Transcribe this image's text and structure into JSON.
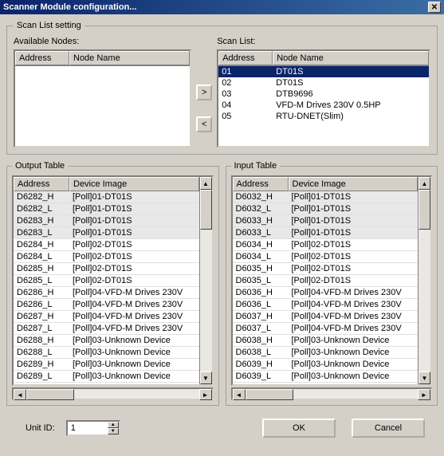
{
  "title": "Scanner Module configuration...",
  "scanListSetting": {
    "legend": "Scan List setting",
    "availableLabel": "Available Nodes:",
    "scanListLabel": "Scan List:",
    "headers": {
      "address": "Address",
      "nodeName": "Node Name"
    },
    "buttons": {
      "right": ">",
      "left": "<"
    },
    "scanList": [
      {
        "address": "01",
        "name": "DT01S",
        "selected": true
      },
      {
        "address": "02",
        "name": "DT01S",
        "selected": false
      },
      {
        "address": "03",
        "name": "DTB9696",
        "selected": false
      },
      {
        "address": "04",
        "name": "VFD-M Drives 230V 0.5HP",
        "selected": false
      },
      {
        "address": "05",
        "name": "RTU-DNET(Slim)",
        "selected": false
      }
    ]
  },
  "outputTable": {
    "legend": "Output Table",
    "headers": {
      "address": "Address",
      "device": "Device Image"
    },
    "rows": [
      {
        "addr": "D6282_H",
        "dev": "[Poll]01-DT01S",
        "shaded": true
      },
      {
        "addr": "D6282_L",
        "dev": "[Poll]01-DT01S",
        "shaded": true
      },
      {
        "addr": "D6283_H",
        "dev": "[Poll]01-DT01S",
        "shaded": true
      },
      {
        "addr": "D6283_L",
        "dev": "[Poll]01-DT01S",
        "shaded": true
      },
      {
        "addr": "D6284_H",
        "dev": "[Poll]02-DT01S",
        "shaded": false
      },
      {
        "addr": "D6284_L",
        "dev": "[Poll]02-DT01S",
        "shaded": false
      },
      {
        "addr": "D6285_H",
        "dev": "[Poll]02-DT01S",
        "shaded": false
      },
      {
        "addr": "D6285_L",
        "dev": "[Poll]02-DT01S",
        "shaded": false
      },
      {
        "addr": "D6286_H",
        "dev": "[Poll]04-VFD-M Drives 230V",
        "shaded": false
      },
      {
        "addr": "D6286_L",
        "dev": "[Poll]04-VFD-M Drives 230V",
        "shaded": false
      },
      {
        "addr": "D6287_H",
        "dev": "[Poll]04-VFD-M Drives 230V",
        "shaded": false
      },
      {
        "addr": "D6287_L",
        "dev": "[Poll]04-VFD-M Drives 230V",
        "shaded": false
      },
      {
        "addr": "D6288_H",
        "dev": "[Poll]03-Unknown Device",
        "shaded": false
      },
      {
        "addr": "D6288_L",
        "dev": "[Poll]03-Unknown Device",
        "shaded": false
      },
      {
        "addr": "D6289_H",
        "dev": "[Poll]03-Unknown Device",
        "shaded": false
      },
      {
        "addr": "D6289_L",
        "dev": "[Poll]03-Unknown Device",
        "shaded": false
      }
    ]
  },
  "inputTable": {
    "legend": "Input Table",
    "headers": {
      "address": "Address",
      "device": "Device Image"
    },
    "rows": [
      {
        "addr": "D6032_H",
        "dev": "[Poll]01-DT01S",
        "shaded": true
      },
      {
        "addr": "D6032_L",
        "dev": "[Poll]01-DT01S",
        "shaded": true
      },
      {
        "addr": "D6033_H",
        "dev": "[Poll]01-DT01S",
        "shaded": true
      },
      {
        "addr": "D6033_L",
        "dev": "[Poll]01-DT01S",
        "shaded": true
      },
      {
        "addr": "D6034_H",
        "dev": "[Poll]02-DT01S",
        "shaded": false
      },
      {
        "addr": "D6034_L",
        "dev": "[Poll]02-DT01S",
        "shaded": false
      },
      {
        "addr": "D6035_H",
        "dev": "[Poll]02-DT01S",
        "shaded": false
      },
      {
        "addr": "D6035_L",
        "dev": "[Poll]02-DT01S",
        "shaded": false
      },
      {
        "addr": "D6036_H",
        "dev": "[Poll]04-VFD-M Drives 230V",
        "shaded": false
      },
      {
        "addr": "D6036_L",
        "dev": "[Poll]04-VFD-M Drives 230V",
        "shaded": false
      },
      {
        "addr": "D6037_H",
        "dev": "[Poll]04-VFD-M Drives 230V",
        "shaded": false
      },
      {
        "addr": "D6037_L",
        "dev": "[Poll]04-VFD-M Drives 230V",
        "shaded": false
      },
      {
        "addr": "D6038_H",
        "dev": "[Poll]03-Unknown Device",
        "shaded": false
      },
      {
        "addr": "D6038_L",
        "dev": "[Poll]03-Unknown Device",
        "shaded": false
      },
      {
        "addr": "D6039_H",
        "dev": "[Poll]03-Unknown Device",
        "shaded": false
      },
      {
        "addr": "D6039_L",
        "dev": "[Poll]03-Unknown Device",
        "shaded": false
      }
    ]
  },
  "bottom": {
    "unitLabel": "Unit ID:",
    "unitValue": "1",
    "ok": "OK",
    "cancel": "Cancel"
  }
}
